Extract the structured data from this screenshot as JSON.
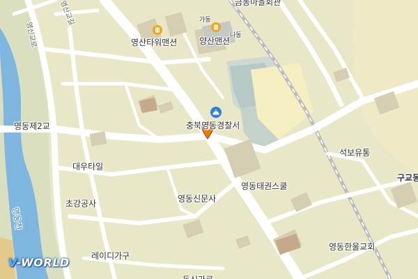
{
  "map": {
    "labels": {
      "yeongsan_tower": "영산타워맨션",
      "ga_dong": "가동",
      "na_dong": "나동",
      "yangsan_mansion": "양산맨션",
      "geumhyang_hall": "금동마을회관",
      "police": "충북영동경찰서",
      "daewoo": "대우타일",
      "chogang": "초강공사",
      "newspaper": "영동신문사",
      "taekwondo": "영동태권스쿨",
      "seokbo": "석보유통",
      "hanul_church": "영동한울교회",
      "lady_furniture": "레이디가구",
      "gugyo": "구교동",
      "bridge": "영동제2교",
      "river": "영동천",
      "road_a": "영신교로",
      "road_b": "영산교길",
      "bottom_cut": "동신가로"
    },
    "logo": {
      "v": "V",
      "rest": "-WORLD"
    },
    "marker_icon": "location-pin-icon",
    "poi_icons": [
      "building-icon",
      "building-icon",
      "police-icon"
    ],
    "colors": {
      "land": "#e6e6c8",
      "road": "#ffffff",
      "river": "#7fb6e0",
      "building": "#d8d0b4",
      "marker": "#e87a12"
    }
  }
}
